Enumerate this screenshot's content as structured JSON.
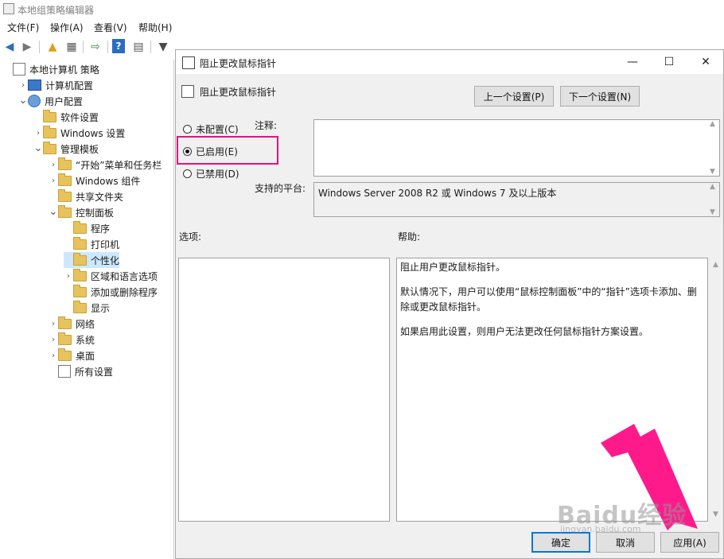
{
  "app": {
    "title": "本地组策略编辑器",
    "menu": [
      "文件(F)",
      "操作(A)",
      "查看(V)",
      "帮助(H)"
    ]
  },
  "toolbar": {
    "icons": [
      "back-icon",
      "forward-icon",
      "up-folder-icon",
      "show-hide-tree-icon",
      "export-icon",
      "help-icon",
      "properties-icon",
      "filter-icon"
    ]
  },
  "tree": {
    "items": [
      {
        "label": "本地计算机 策略",
        "indent": 0,
        "expander": "",
        "icon": "doc"
      },
      {
        "label": "计算机配置",
        "indent": 1,
        "expander": ">",
        "icon": "pc"
      },
      {
        "label": "用户配置",
        "indent": 1,
        "expander": "v",
        "icon": "user"
      },
      {
        "label": "软件设置",
        "indent": 2,
        "expander": "",
        "icon": "folder"
      },
      {
        "label": "Windows 设置",
        "indent": 2,
        "expander": ">",
        "icon": "folder"
      },
      {
        "label": "管理模板",
        "indent": 2,
        "expander": "v",
        "icon": "folder"
      },
      {
        "label": "“开始”菜单和任务栏",
        "indent": 3,
        "expander": ">",
        "icon": "folder"
      },
      {
        "label": "Windows 组件",
        "indent": 3,
        "expander": ">",
        "icon": "folder"
      },
      {
        "label": "共享文件夹",
        "indent": 3,
        "expander": "",
        "icon": "folder"
      },
      {
        "label": "控制面板",
        "indent": 3,
        "expander": "v",
        "icon": "folder"
      },
      {
        "label": "程序",
        "indent": 4,
        "expander": "",
        "icon": "folder"
      },
      {
        "label": "打印机",
        "indent": 4,
        "expander": "",
        "icon": "folder"
      },
      {
        "label": "个性化",
        "indent": 4,
        "expander": "",
        "icon": "folder",
        "selected": true
      },
      {
        "label": "区域和语言选项",
        "indent": 4,
        "expander": ">",
        "icon": "folder"
      },
      {
        "label": "添加或删除程序",
        "indent": 4,
        "expander": "",
        "icon": "folder"
      },
      {
        "label": "显示",
        "indent": 4,
        "expander": "",
        "icon": "folder"
      },
      {
        "label": "网络",
        "indent": 3,
        "expander": ">",
        "icon": "folder"
      },
      {
        "label": "系统",
        "indent": 3,
        "expander": ">",
        "icon": "folder"
      },
      {
        "label": "桌面",
        "indent": 3,
        "expander": ">",
        "icon": "folder"
      },
      {
        "label": "所有设置",
        "indent": 3,
        "expander": "",
        "icon": "doc"
      }
    ]
  },
  "dialog": {
    "title": "阻止更改鼠标指针",
    "setting_name": "阻止更改鼠标指针",
    "prev_button": "上一个设置(P)",
    "next_button": "下一个设置(N)",
    "radios": {
      "not_configured": "未配置(C)",
      "enabled": "已启用(E)",
      "disabled": "已禁用(D)"
    },
    "selected_state": "enabled",
    "comment_label": "注释:",
    "comment_value": "",
    "supported_label": "支持的平台:",
    "supported_value": "Windows Server 2008 R2 或 Windows 7 及以上版本",
    "options_label": "选项:",
    "help_label": "帮助:",
    "help_text": [
      "阻止用户更改鼠标指针。",
      "默认情况下，用户可以使用“鼠标控制面板”中的“指针”选项卡添加、删除或更改鼠标指针。",
      "如果启用此设置，则用户无法更改任何鼠标指针方案设置。"
    ],
    "ok_button": "确定",
    "cancel_button": "取消",
    "apply_button": "应用(A)"
  },
  "annotation": {
    "highlight_color": "#e5127d",
    "arrow_color": "#ff1a8c"
  },
  "watermark": {
    "text": "Baidu经验",
    "sub": "jingyan.baidu.com"
  }
}
